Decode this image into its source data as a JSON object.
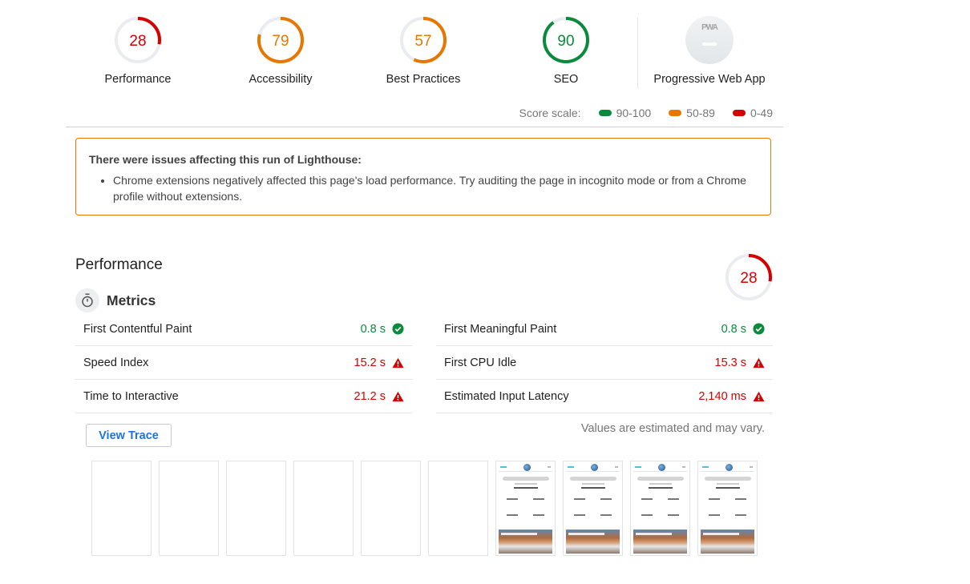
{
  "colors": {
    "pass": "#0b8a3b",
    "average": "#e67700",
    "fail": "#d50000",
    "track": "#ebecef",
    "link": "#1a73e8"
  },
  "categories": [
    {
      "label": "Performance",
      "score": 28,
      "status": "fail"
    },
    {
      "label": "Accessibility",
      "score": 79,
      "status": "average"
    },
    {
      "label": "Best Practices",
      "score": 57,
      "status": "average"
    },
    {
      "label": "SEO",
      "score": 90,
      "status": "pass"
    }
  ],
  "pwa": {
    "label": "Progressive Web App",
    "badge_text": "PWA",
    "icon": "pwa-badge-icon"
  },
  "score_scale": {
    "label": "Score scale:",
    "ranges": [
      {
        "label": "90-100",
        "status": "pass"
      },
      {
        "label": "50-89",
        "status": "average"
      },
      {
        "label": "0-49",
        "status": "fail"
      }
    ]
  },
  "warning": {
    "title": "There were issues affecting this run of Lighthouse:",
    "items": [
      "Chrome extensions negatively affected this page's load performance. Try auditing the page in incognito mode or from a Chrome profile without extensions."
    ]
  },
  "performance": {
    "title": "Performance",
    "score": 28,
    "status": "fail",
    "metrics_title": "Metrics",
    "metrics_icon": "stopwatch-icon",
    "metrics_left": [
      {
        "label": "First Contentful Paint",
        "value": "0.8 s",
        "status": "pass"
      },
      {
        "label": "Speed Index",
        "value": "15.2 s",
        "status": "fail"
      },
      {
        "label": "Time to Interactive",
        "value": "21.2 s",
        "status": "fail"
      }
    ],
    "metrics_right": [
      {
        "label": "First Meaningful Paint",
        "value": "0.8 s",
        "status": "pass"
      },
      {
        "label": "First CPU Idle",
        "value": "15.3 s",
        "status": "fail"
      },
      {
        "label": "Estimated Input Latency",
        "value": "2,140 ms",
        "status": "fail"
      }
    ],
    "disclaimer": "Values are estimated and may vary.",
    "view_trace_label": "View Trace",
    "filmstrip": {
      "frames": [
        {
          "state": "blank"
        },
        {
          "state": "blank"
        },
        {
          "state": "blank"
        },
        {
          "state": "blank"
        },
        {
          "state": "blank"
        },
        {
          "state": "blank"
        },
        {
          "state": "rendered"
        },
        {
          "state": "rendered"
        },
        {
          "state": "rendered"
        },
        {
          "state": "rendered"
        }
      ]
    }
  }
}
